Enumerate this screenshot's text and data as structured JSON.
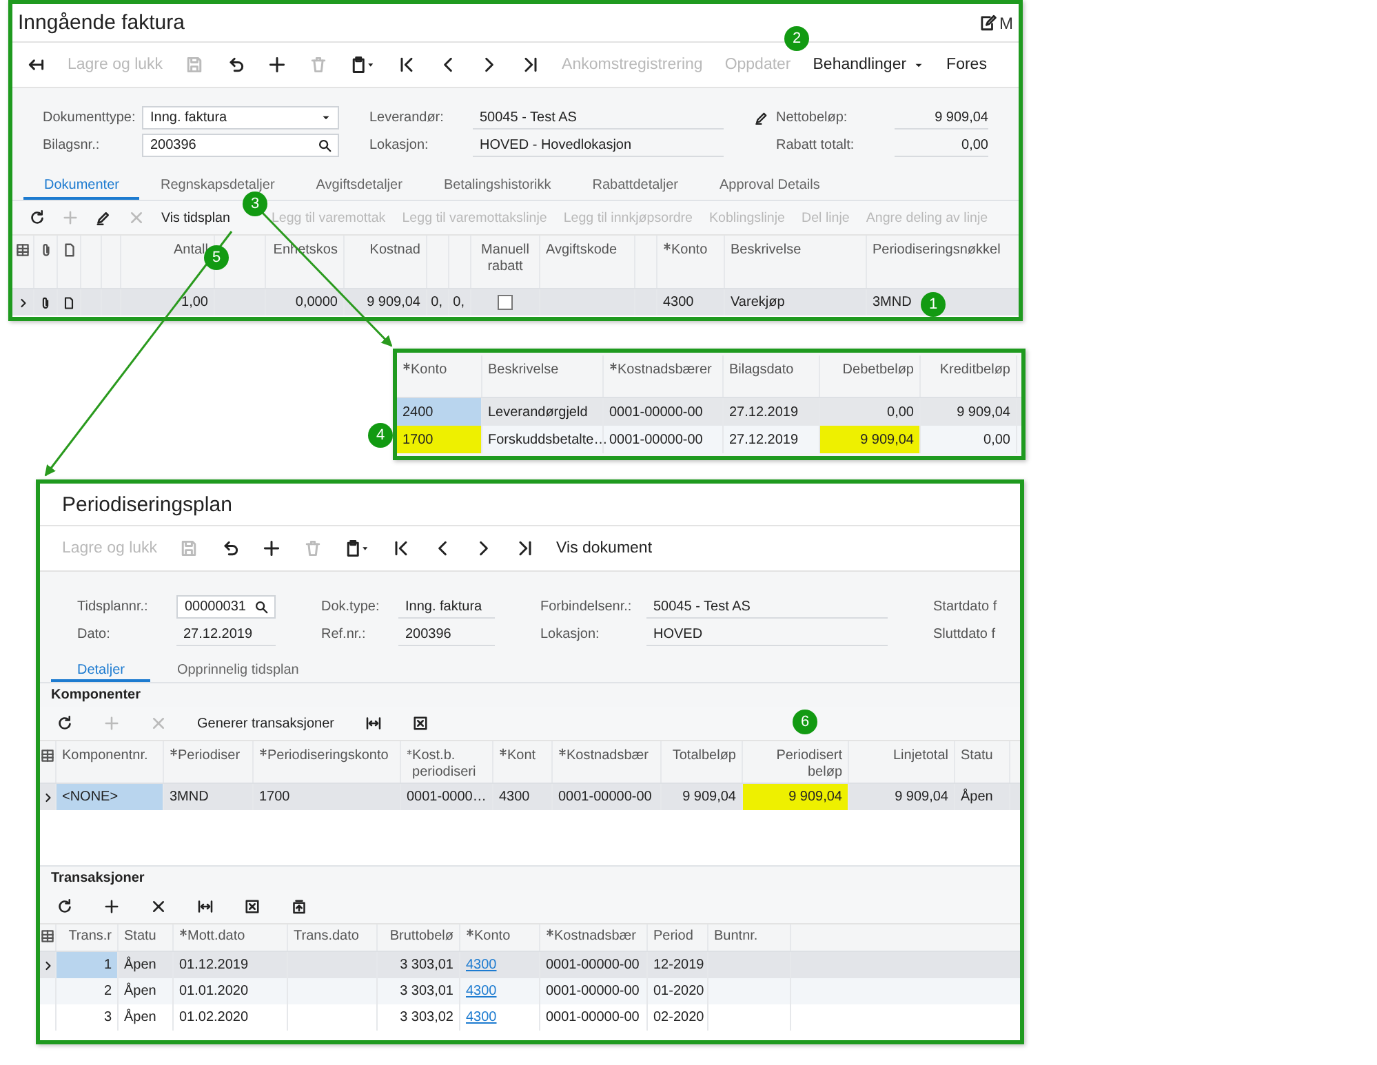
{
  "invoice": {
    "title": "Inngående faktura",
    "corner_label": "M",
    "toolbar": [
      {
        "kind": "icon",
        "disabled": false
      },
      {
        "kind": "text",
        "label": "Lagre og lukk",
        "disabled": true
      },
      {
        "kind": "icon",
        "disabled": true
      },
      {
        "kind": "icon",
        "disabled": false
      },
      {
        "kind": "icon",
        "disabled": false
      },
      {
        "kind": "icon",
        "disabled": true
      },
      {
        "kind": "icon",
        "disabled": false
      },
      {
        "kind": "icon",
        "disabled": false
      },
      {
        "kind": "icon",
        "disabled": false
      },
      {
        "kind": "icon",
        "disabled": false
      },
      {
        "kind": "icon",
        "disabled": false
      },
      {
        "kind": "text",
        "label": "Ankomstregistrering",
        "disabled": true
      },
      {
        "kind": "text",
        "label": "Oppdater",
        "disabled": true
      },
      {
        "kind": "menu",
        "label": "Behandlinger",
        "disabled": false
      },
      {
        "kind": "text",
        "label": "Fores",
        "disabled": false
      }
    ],
    "form": [
      [
        {
          "label": "Dokumenttype:",
          "value": "Inng. faktura",
          "kind": "select"
        },
        {
          "label": "Bilagsnr.:",
          "value": "200396",
          "kind": "lookup"
        }
      ],
      [
        {
          "label": "Leverandør:",
          "value": "50045 - Test AS",
          "kind": "text"
        },
        {
          "label": "Lokasjon:",
          "value": "HOVED - Hovedlokasjon",
          "kind": "text"
        }
      ],
      [
        {
          "label": "Nettobeløp:",
          "value": "9 909,04",
          "kind": "amount"
        },
        {
          "label": "Rabatt totalt:",
          "value": "0,00",
          "kind": "amount"
        }
      ]
    ],
    "tabs": [
      {
        "label": "Dokumenter",
        "selected": true
      },
      {
        "label": "Regnskapsdetaljer",
        "selected": false
      },
      {
        "label": "Avgiftsdetaljer",
        "selected": false
      },
      {
        "label": "Betalingshistorikk",
        "selected": false
      },
      {
        "label": "Rabattdetaljer",
        "selected": false
      },
      {
        "label": "Approval Details",
        "selected": false
      }
    ],
    "grid_toolbar": [
      {
        "kind": "icon",
        "disabled": false
      },
      {
        "kind": "icon",
        "disabled": true
      },
      {
        "kind": "icon",
        "disabled": false
      },
      {
        "kind": "icon",
        "disabled": true
      },
      {
        "kind": "text",
        "label": "Vis tidsplan",
        "disabled": false
      },
      {
        "kind": "text",
        "label": "Legg til varemottak",
        "disabled": true
      },
      {
        "kind": "text",
        "label": "Legg til varemottakslinje",
        "disabled": true
      },
      {
        "kind": "text",
        "label": "Legg til innkjøpsordre",
        "disabled": true
      },
      {
        "kind": "text",
        "label": "Koblingslinje",
        "disabled": true
      },
      {
        "kind": "text",
        "label": "Del linje",
        "disabled": true
      },
      {
        "kind": "text",
        "label": "Angre deling av linje",
        "disabled": true
      }
    ],
    "grid": {
      "columns": [
        {
          "label": "Antall",
          "kind": "number"
        },
        {
          "kind": "text"
        },
        {
          "label": "Enhetskos",
          "kind": "number"
        },
        {
          "label": "Kostnad",
          "kind": "number"
        },
        {
          "kind": "number"
        },
        {
          "kind": "number"
        },
        {
          "label": "Manuell rabatt",
          "kind": "check"
        },
        {
          "label": "Avgiftskode",
          "kind": "text"
        },
        {
          "kind": "text"
        },
        {
          "label": "Konto",
          "kind": "text",
          "required": true
        },
        {
          "label": "Beskrivelse",
          "kind": "text"
        },
        {
          "label": "Periodiseringsnøkkel",
          "kind": "text"
        }
      ],
      "rows": [
        {
          "selected": true,
          "cells": [
            "1,00",
            null,
            "0,0000",
            "9 909,04",
            "0,",
            "0,",
            false,
            null,
            null,
            "4300",
            "Varekjøp",
            "3MND"
          ]
        }
      ]
    }
  },
  "journal": {
    "columns": [
      {
        "label": "Konto",
        "kind": "text",
        "required": true
      },
      {
        "label": "Beskrivelse",
        "kind": "text"
      },
      {
        "label": "Kostnadsbærer",
        "kind": "text",
        "required": true
      },
      {
        "label": "Bilagsdato",
        "kind": "text"
      },
      {
        "label": "Debetbeløp",
        "kind": "number"
      },
      {
        "label": "Kreditbeløp",
        "kind": "number"
      }
    ],
    "rows": [
      {
        "selected": true,
        "cells": [
          {
            "text": "2400",
            "active": true
          },
          "Leverandørgjeld",
          "0001-00000-00",
          "27.12.2019",
          "0,00",
          "9 909,04"
        ]
      },
      {
        "selected": false,
        "cells": [
          {
            "text": "1700",
            "highlighted": true
          },
          "Forskuddsbetalte…",
          "0001-00000-00",
          "27.12.2019",
          {
            "text": "9 909,04",
            "highlighted": true
          },
          "0,00"
        ]
      }
    ]
  },
  "schedule": {
    "title": "Periodiseringsplan",
    "toolbar": [
      {
        "kind": "text",
        "label": "Lagre og lukk",
        "disabled": true
      },
      {
        "kind": "icon",
        "disabled": true
      },
      {
        "kind": "icon",
        "disabled": false
      },
      {
        "kind": "icon",
        "disabled": false
      },
      {
        "kind": "icon",
        "disabled": true
      },
      {
        "kind": "icon",
        "disabled": false
      },
      {
        "kind": "icon",
        "disabled": false
      },
      {
        "kind": "icon",
        "disabled": false
      },
      {
        "kind": "icon",
        "disabled": false
      },
      {
        "kind": "icon",
        "disabled": false
      },
      {
        "kind": "text",
        "label": "Vis dokument",
        "disabled": false
      }
    ],
    "form": [
      [
        {
          "label": "Tidsplannr.:",
          "value": "00000031",
          "kind": "lookup"
        },
        {
          "label": "Dato:",
          "value": "27.12.2019",
          "kind": "text"
        }
      ],
      [
        {
          "label": "Dok.type:",
          "value": "Inng. faktura",
          "kind": "text"
        },
        {
          "label": "Ref.nr.:",
          "value": "200396",
          "kind": "text"
        }
      ],
      [
        {
          "label": "Forbindelsenr.:",
          "value": "50045 - Test AS",
          "kind": "text"
        },
        {
          "label": "Lokasjon:",
          "value": "HOVED",
          "kind": "text"
        }
      ],
      [
        {
          "label": "Startdato f",
          "kind": "label"
        },
        {
          "label": "Sluttdato f",
          "kind": "label"
        }
      ]
    ],
    "tabs": [
      {
        "label": "Detaljer",
        "selected": true
      },
      {
        "label": "Opprinnelig tidsplan",
        "selected": false
      }
    ],
    "components": {
      "heading": "Komponenter",
      "toolbar": [
        {
          "kind": "icon",
          "disabled": false
        },
        {
          "kind": "icon",
          "disabled": true
        },
        {
          "kind": "icon",
          "disabled": true
        },
        {
          "kind": "text",
          "label": "Generer transaksjoner",
          "disabled": false
        },
        {
          "kind": "icon",
          "disabled": false
        },
        {
          "kind": "icon",
          "disabled": false
        }
      ],
      "columns": [
        {
          "label": "Komponentnr.",
          "kind": "text"
        },
        {
          "label": "Periodiser",
          "kind": "text",
          "required": true
        },
        {
          "label": "Periodiseringskonto",
          "kind": "text",
          "required": true
        },
        {
          "label": "Kost.b. periodiseri",
          "kind": "text",
          "required": true
        },
        {
          "label": "Kont",
          "kind": "text",
          "required": true
        },
        {
          "label": "Kostnadsbær",
          "kind": "text",
          "required": true
        },
        {
          "label": "Totalbeløp",
          "kind": "number"
        },
        {
          "label": "Periodisert beløp",
          "kind": "number"
        },
        {
          "label": "Linjetotal",
          "kind": "number"
        },
        {
          "label": "Statu",
          "kind": "text"
        }
      ],
      "rows": [
        {
          "selected": true,
          "cells": [
            {
              "text": "<NONE>",
              "active": true
            },
            "3MND",
            "1700",
            "0001-0000…",
            "4300",
            "0001-00000-00",
            "9 909,04",
            {
              "text": "9 909,04",
              "highlighted": true
            },
            "9 909,04",
            "Åpen"
          ]
        }
      ]
    },
    "transactions": {
      "heading": "Transaksjoner",
      "toolbar": [
        {
          "kind": "icon",
          "disabled": false
        },
        {
          "kind": "icon",
          "disabled": false
        },
        {
          "kind": "icon",
          "disabled": false
        },
        {
          "kind": "icon",
          "disabled": false
        },
        {
          "kind": "icon",
          "disabled": false
        },
        {
          "kind": "icon",
          "disabled": false
        }
      ],
      "columns": [
        {
          "label": "Trans.r",
          "kind": "number"
        },
        {
          "label": "Statu",
          "kind": "text"
        },
        {
          "label": "Mott.dato",
          "kind": "text",
          "required": true
        },
        {
          "label": "Trans.dato",
          "kind": "text"
        },
        {
          "label": "Bruttobelø",
          "kind": "number"
        },
        {
          "label": "Konto",
          "kind": "link",
          "required": true
        },
        {
          "label": "Kostnadsbær",
          "kind": "text",
          "required": true
        },
        {
          "label": "Period",
          "kind": "text"
        },
        {
          "label": "Buntnr.",
          "kind": "text"
        }
      ],
      "rows": [
        {
          "selected": true,
          "cells": [
            {
              "text": "1",
              "active": true
            },
            "Åpen",
            "01.12.2019",
            null,
            "3 303,01",
            "4300",
            "0001-00000-00",
            "12-2019",
            null
          ]
        },
        {
          "selected": false,
          "cells": [
            "2",
            "Åpen",
            "01.01.2020",
            null,
            "3 303,01",
            "4300",
            "0001-00000-00",
            "01-2020",
            null
          ]
        },
        {
          "selected": false,
          "cells": [
            "3",
            "Åpen",
            "01.02.2020",
            null,
            "3 303,02",
            "4300",
            "0001-00000-00",
            "02-2020",
            null
          ]
        }
      ]
    }
  },
  "annotations": [
    {
      "label": "1"
    },
    {
      "label": "2"
    },
    {
      "label": "3"
    },
    {
      "label": "4"
    },
    {
      "label": "5"
    },
    {
      "label": "6"
    }
  ]
}
